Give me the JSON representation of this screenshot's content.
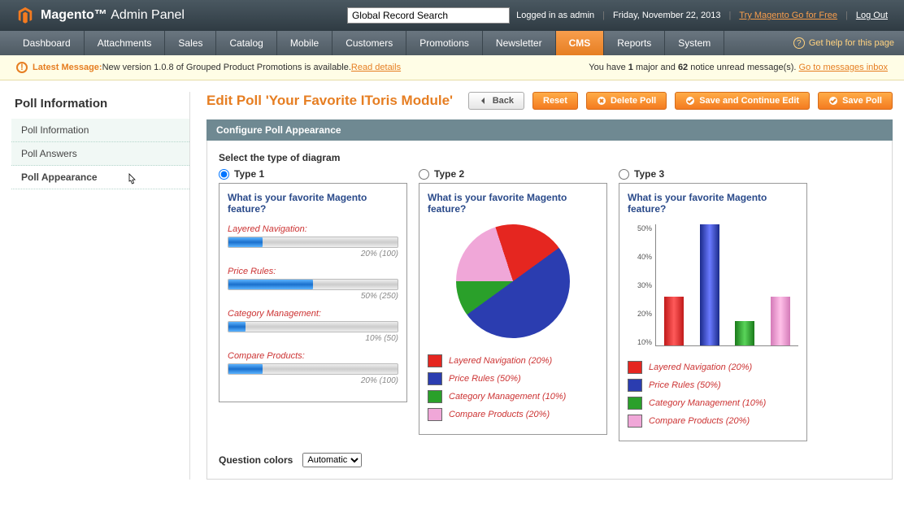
{
  "header": {
    "brand_bold": "Magento",
    "brand_thin": "Admin Panel",
    "search_placeholder": "Global Record Search",
    "logged_in": "Logged in as admin",
    "date": "Friday, November 22, 2013",
    "try_link": "Try Magento Go for Free",
    "logout": "Log Out"
  },
  "nav": {
    "items": [
      "Dashboard",
      "Attachments",
      "Sales",
      "Catalog",
      "Mobile",
      "Customers",
      "Promotions",
      "Newsletter",
      "CMS",
      "Reports",
      "System"
    ],
    "active": "CMS",
    "help": "Get help for this page"
  },
  "notice": {
    "latest_label": "Latest Message:",
    "latest_text": " New version 1.0.8 of Grouped Product Promotions is available. ",
    "read_details": "Read details",
    "right_pre": "You have ",
    "major": "1",
    "mid": " major and ",
    "notice_count": "62",
    "post": " notice unread message(s). ",
    "inbox_link": "Go to messages inbox"
  },
  "sidebar": {
    "title": "Poll Information",
    "items": [
      "Poll Information",
      "Poll Answers",
      "Poll Appearance"
    ]
  },
  "page": {
    "title": "Edit Poll 'Your Favorite IToris Module'",
    "btn_back": "Back",
    "btn_reset": "Reset",
    "btn_delete": "Delete Poll",
    "btn_save_continue": "Save and Continue Edit",
    "btn_save": "Save Poll"
  },
  "section": {
    "title": "Configure Poll Appearance",
    "select_label": "Select the type of diagram",
    "type1": "Type 1",
    "type2": "Type 2",
    "type3": "Type 3",
    "question": "What is your favorite Magento feature?",
    "qcolors_label": "Question colors",
    "qcolors_value": "Automatic"
  },
  "chart_data": {
    "question": "What is your favorite Magento feature?",
    "series": [
      {
        "name": "Layered Navigation",
        "percent": 20,
        "votes": 100,
        "color": "#e52620"
      },
      {
        "name": "Price Rules",
        "percent": 50,
        "votes": 250,
        "color": "#2b3db0"
      },
      {
        "name": "Category Management",
        "percent": 10,
        "votes": 50,
        "color": "#2aa02a"
      },
      {
        "name": "Compare Products",
        "percent": 20,
        "votes": 100,
        "color": "#f0a7d8"
      }
    ],
    "type1": {
      "type": "bar",
      "orientation": "horizontal"
    },
    "type2": {
      "type": "pie"
    },
    "type3": {
      "type": "bar",
      "orientation": "vertical",
      "ylim": [
        0,
        50
      ],
      "yticks": [
        "50%",
        "40%",
        "30%",
        "20%",
        "10%"
      ]
    }
  },
  "legend": {
    "0": "Layered Navigation (20%)",
    "1": "Price Rules (50%)",
    "2": "Category Management (10%)",
    "3": "Compare Products (20%)"
  },
  "bar_display": {
    "0": {
      "label": "Layered Navigation:",
      "val": "20% (100)"
    },
    "1": {
      "label": "Price Rules:",
      "val": "50% (250)"
    },
    "2": {
      "label": "Category Management:",
      "val": "10% (50)"
    },
    "3": {
      "label": "Compare Products:",
      "val": "20% (100)"
    }
  }
}
